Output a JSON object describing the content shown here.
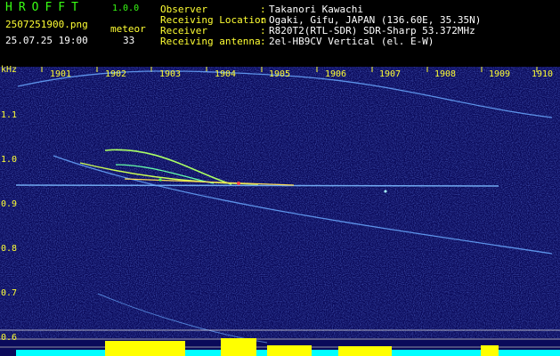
{
  "app": {
    "title": "HROFFT",
    "version": "1.0.0",
    "filename": "2507251900.png",
    "datetime": "25.07.25 19:00",
    "meteor_label": "meteor",
    "meteor_count": "33"
  },
  "info": [
    {
      "key": "Observer",
      "value": "Takanori Kawachi"
    },
    {
      "key": "Receiving Location",
      "value": "Ogaki, Gifu, JAPAN (136.60E, 35.35N)"
    },
    {
      "key": "Receiver",
      "value": "R820T2(RTL-SDR) SDR-Sharp 53.372MHz"
    },
    {
      "key": "Receiving antenna",
      "value": "2el-HB9CV Vertical (el. E-W)"
    }
  ],
  "separator": ":",
  "spectrogram": {
    "y_unit": "kHz",
    "x_ticks": [
      "1901",
      "1902",
      "1903",
      "1904",
      "1905",
      "1906",
      "1907",
      "1908",
      "1909",
      "1910"
    ],
    "y_ticks": [
      "1.1",
      "1.0",
      "0.9",
      "0.8",
      "0.7",
      "0.6"
    ],
    "colors": {
      "background": "#0a0a5a",
      "trace": "#7ab8ff",
      "label": "#ffff33",
      "bars": "#ffff00",
      "baseline": "#00ffff"
    }
  }
}
